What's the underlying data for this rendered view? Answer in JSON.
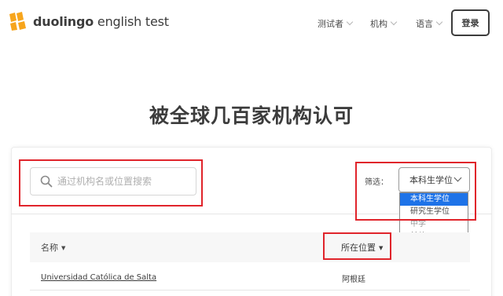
{
  "header": {
    "logo_brand": "duolingo",
    "logo_suffix": " english test",
    "nav": [
      "测试者",
      "机构",
      "语言"
    ],
    "login_label": "登录"
  },
  "hero": {
    "title": "被全球几百家机构认可"
  },
  "search": {
    "placeholder": "通过机构名或位置搜索",
    "value": ""
  },
  "filter": {
    "label": "筛选：",
    "selected": "本科生学位",
    "options": [
      "本科生学位",
      "研究生学位",
      "中学",
      "其他"
    ]
  },
  "table": {
    "columns": [
      "名称",
      "所在位置"
    ],
    "rows": [
      {
        "name": "Universidad Católica de Salta",
        "location": "阿根廷"
      }
    ]
  },
  "colors": {
    "annotation_red": "#e0242b",
    "dropdown_selected": "#1e73e8",
    "logo_orange": "#f7a51c"
  },
  "icons": [
    "duolingo-logo-icon",
    "search-icon",
    "chevron-down-icon",
    "sort-caret-icon"
  ]
}
